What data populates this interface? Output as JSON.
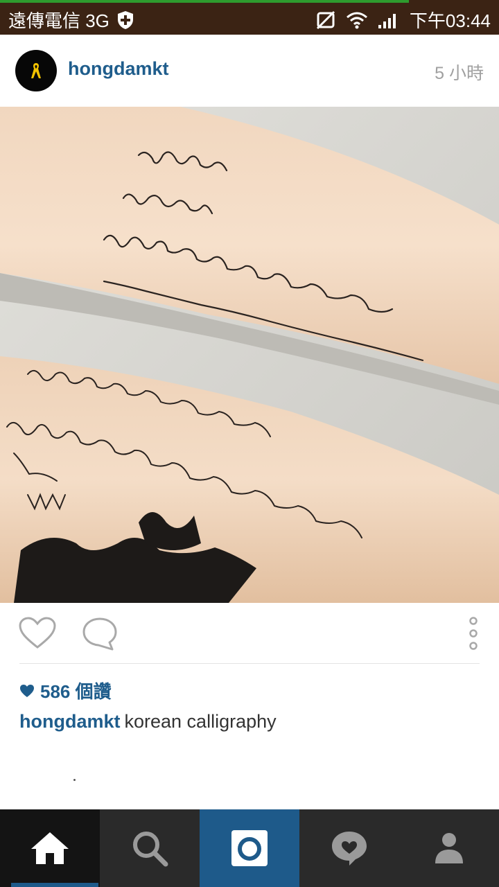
{
  "status_bar": {
    "carrier": "遠傳電信 3G",
    "time": "下午03:44",
    "icons": [
      "shield-icon",
      "mute-icon",
      "wifi-icon",
      "signal-icon"
    ],
    "background": "#3b2314"
  },
  "post": {
    "username": "hongdamkt",
    "time_ago": "5 小時",
    "photo_description_icon": "tattoo-photo",
    "likes": "586 個讚",
    "caption_user": "hongdamkt",
    "caption_text": "korean calligraphy",
    "more_text": "."
  },
  "actions": {
    "icons": [
      "heart-outline-icon",
      "comment-icon",
      "more-vertical-icon"
    ]
  },
  "tab_bar": {
    "tabs": [
      "home",
      "search",
      "camera",
      "activity",
      "profile"
    ],
    "active": "home",
    "accent": "#1e5a8a"
  }
}
